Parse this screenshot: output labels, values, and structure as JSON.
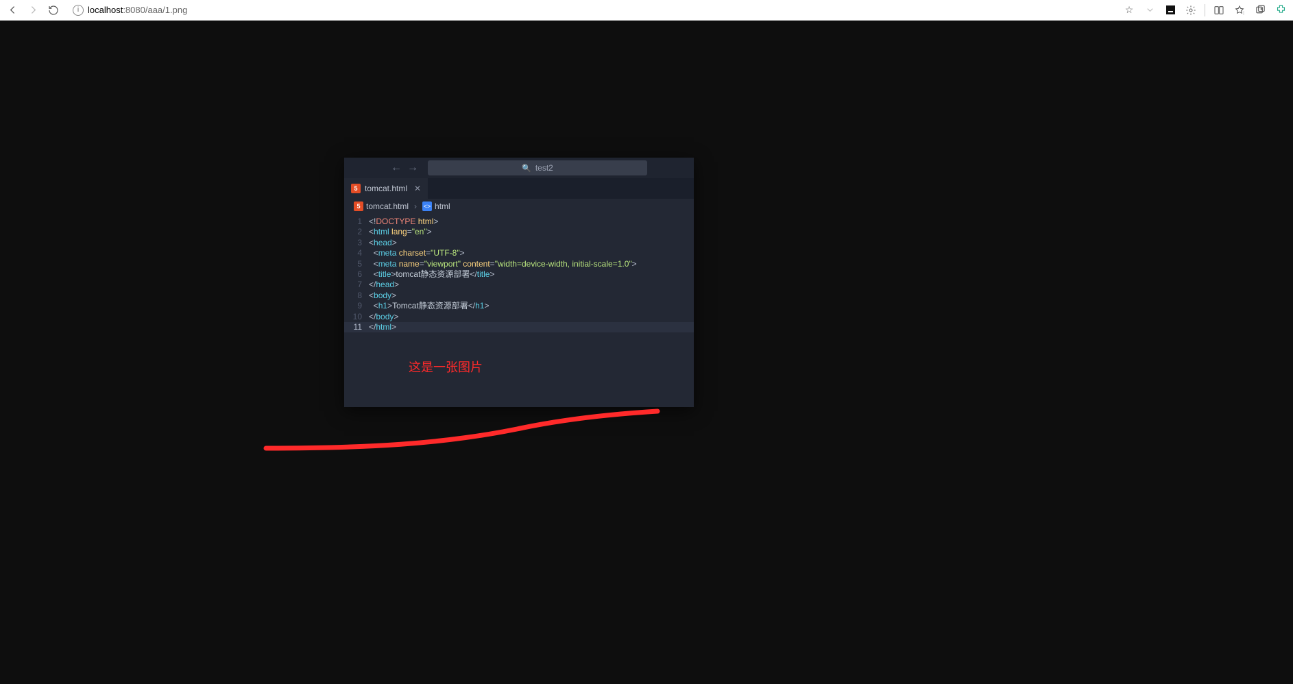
{
  "browser": {
    "url_host": "localhost",
    "url_port": ":8080",
    "url_path": "/aaa/1.png"
  },
  "panel": {
    "search_text": "test2",
    "tab_label": "tomcat.html",
    "crumb_file": "tomcat.html",
    "crumb_node": "html"
  },
  "code": {
    "lines": [
      {
        "n": "1",
        "tokens": [
          [
            "pun",
            "<!"
          ],
          [
            "doc",
            "DOCTYPE "
          ],
          [
            "attr",
            "html"
          ],
          [
            "pun",
            ">"
          ]
        ]
      },
      {
        "n": "2",
        "tokens": [
          [
            "pun",
            "<"
          ],
          [
            "tag",
            "html "
          ],
          [
            "attr",
            "lang"
          ],
          [
            "pun",
            "="
          ],
          [
            "str",
            "\"en\""
          ],
          [
            "pun",
            ">"
          ]
        ]
      },
      {
        "n": "3",
        "tokens": [
          [
            "pun",
            "<"
          ],
          [
            "tag",
            "head"
          ],
          [
            "pun",
            ">"
          ]
        ]
      },
      {
        "n": "4",
        "indent": 1,
        "tokens": [
          [
            "pun",
            "<"
          ],
          [
            "tag",
            "meta "
          ],
          [
            "attr",
            "charset"
          ],
          [
            "pun",
            "="
          ],
          [
            "str",
            "\"UTF-8\""
          ],
          [
            "pun",
            ">"
          ]
        ]
      },
      {
        "n": "5",
        "indent": 1,
        "tokens": [
          [
            "pun",
            "<"
          ],
          [
            "tag",
            "meta "
          ],
          [
            "attr",
            "name"
          ],
          [
            "pun",
            "="
          ],
          [
            "str",
            "\"viewport\" "
          ],
          [
            "attr",
            "content"
          ],
          [
            "pun",
            "="
          ],
          [
            "str",
            "\"width=device-width, initial-scale=1.0\""
          ],
          [
            "pun",
            ">"
          ]
        ]
      },
      {
        "n": "6",
        "indent": 1,
        "tokens": [
          [
            "pun",
            "<"
          ],
          [
            "tag",
            "title"
          ],
          [
            "pun",
            ">"
          ],
          [
            "txt",
            "tomcat静态资源部署"
          ],
          [
            "pun",
            "</"
          ],
          [
            "tag",
            "title"
          ],
          [
            "pun",
            ">"
          ]
        ]
      },
      {
        "n": "7",
        "tokens": [
          [
            "pun",
            "</"
          ],
          [
            "tag",
            "head"
          ],
          [
            "pun",
            ">"
          ]
        ]
      },
      {
        "n": "8",
        "tokens": [
          [
            "pun",
            "<"
          ],
          [
            "tag",
            "body"
          ],
          [
            "pun",
            ">"
          ]
        ]
      },
      {
        "n": "9",
        "indent": 1,
        "tokens": [
          [
            "pun",
            "<"
          ],
          [
            "tag",
            "h1"
          ],
          [
            "pun",
            ">"
          ],
          [
            "txt",
            "Tomcat静态资源部署"
          ],
          [
            "pun",
            "</"
          ],
          [
            "tag",
            "h1"
          ],
          [
            "pun",
            ">"
          ]
        ]
      },
      {
        "n": "10",
        "tokens": [
          [
            "pun",
            "</"
          ],
          [
            "tag",
            "body"
          ],
          [
            "pun",
            ">"
          ]
        ]
      },
      {
        "n": "11",
        "active": true,
        "tokens": [
          [
            "pun",
            "</"
          ],
          [
            "tag",
            "html"
          ],
          [
            "pun",
            ">"
          ]
        ]
      }
    ]
  },
  "caption_text": "这是一张图片"
}
